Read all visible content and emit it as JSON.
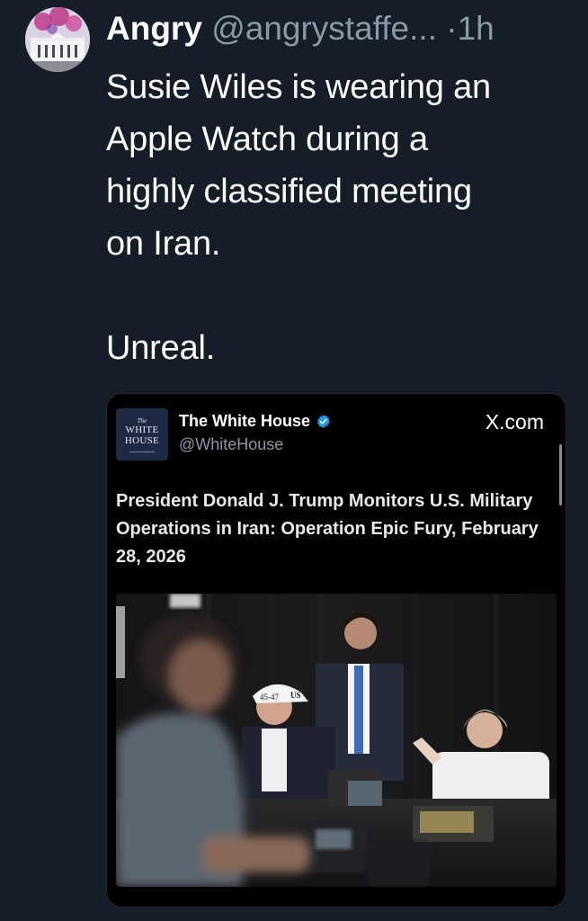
{
  "tweet": {
    "author_name": "Angry",
    "author_handle": "@angrystaffe...",
    "separator": "·",
    "time": "1h",
    "text_lines": [
      "Susie Wiles is wearing an",
      "Apple Watch during a",
      "highly classified meeting",
      "on Iran."
    ],
    "text_after": "Unreal."
  },
  "embed": {
    "logo": {
      "small": "The",
      "line1": "WHITE",
      "line2": "HOUSE"
    },
    "account_name": "The White House",
    "account_handle": "@WhiteHouse",
    "source": "X.com",
    "headline": "President Donald J. Trump Monitors U.S. Military Operations in Iran: Operation Epic Fury, February 28, 2026",
    "photo": {
      "cap_text": "45-47",
      "cap_text_side": "US"
    }
  },
  "colors": {
    "background": "#151d28",
    "secondary_text": "#8b98a5",
    "verified_blue": "#1d9bf0"
  },
  "icons": [
    "white-house-avatar",
    "verified-badge-icon",
    "white-house-logo"
  ]
}
